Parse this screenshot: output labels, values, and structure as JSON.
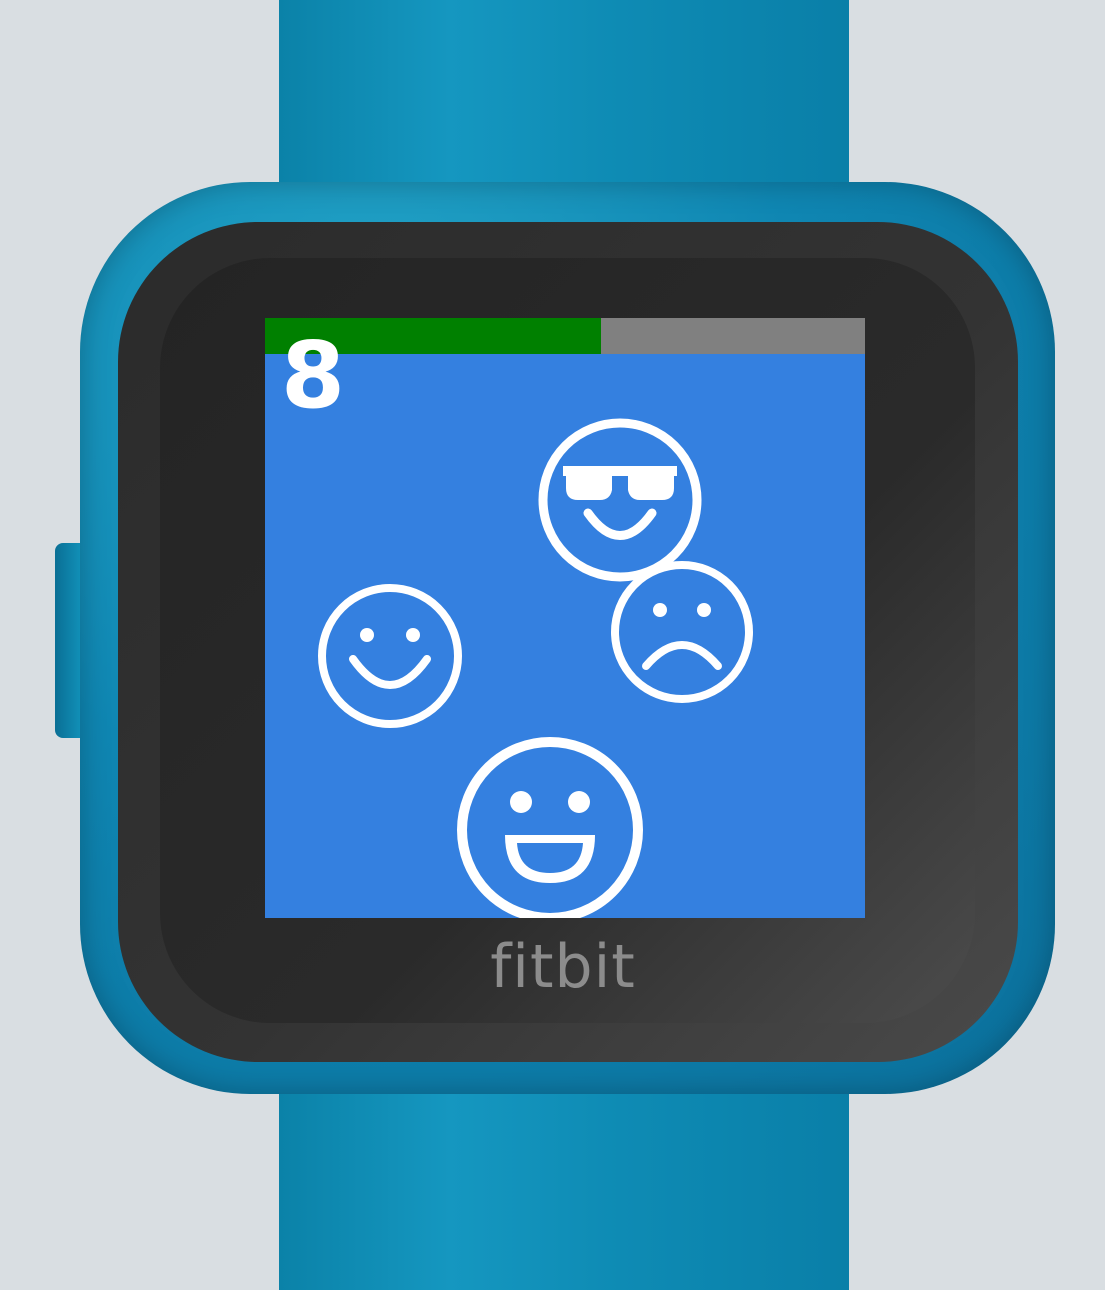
{
  "device": {
    "brand": "fitbit",
    "strap_color": "#0e8bb4",
    "case_color": "#1590bb"
  },
  "game": {
    "score": "8",
    "timer_fraction": 0.56,
    "colors": {
      "background": "#3480e0",
      "timer_fill": "#008000",
      "timer_track": "#808080",
      "foreground": "#ffffff"
    },
    "emojis": [
      {
        "kind": "sunglasses-smiley"
      },
      {
        "kind": "sad-face"
      },
      {
        "kind": "smiley"
      },
      {
        "kind": "grinning-face"
      }
    ]
  }
}
